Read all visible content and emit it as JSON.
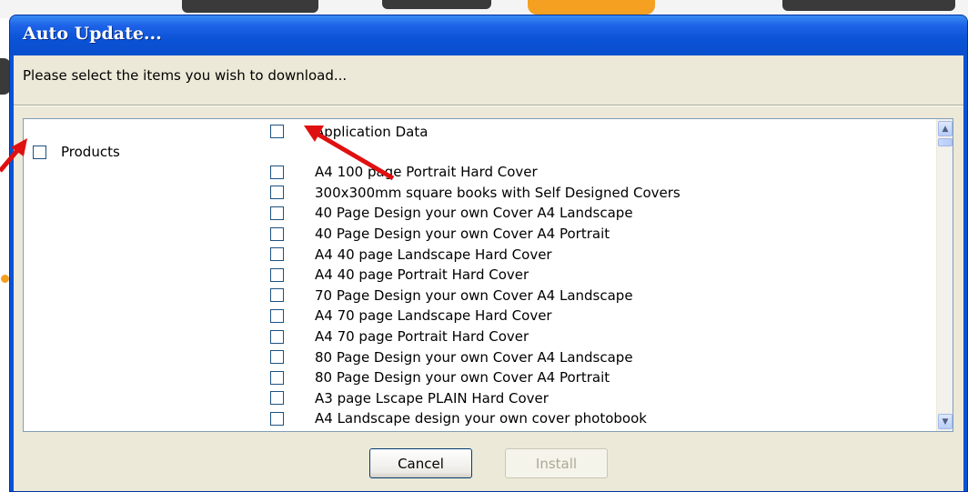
{
  "window": {
    "title": "Auto Update...",
    "prompt": "Please select the items you wish to download..."
  },
  "categories": [
    {
      "label": "Products",
      "checked": false
    }
  ],
  "items": [
    {
      "label": "Application Data",
      "checked": false
    },
    {
      "label": "A4 100 page Portrait Hard Cover",
      "checked": false
    },
    {
      "label": "300x300mm square books with Self Designed Covers",
      "checked": false
    },
    {
      "label": "40 Page Design your own Cover A4 Landscape",
      "checked": false
    },
    {
      "label": "40 Page Design your own Cover A4 Portrait",
      "checked": false
    },
    {
      "label": "A4 40 page Landscape Hard Cover",
      "checked": false
    },
    {
      "label": "A4 40 page Portrait Hard Cover",
      "checked": false
    },
    {
      "label": "70 Page Design your own Cover A4 Landscape",
      "checked": false
    },
    {
      "label": "A4 70 page Landscape Hard Cover",
      "checked": false
    },
    {
      "label": "A4 70 page Portrait Hard Cover",
      "checked": false
    },
    {
      "label": "80 Page Design your own Cover A4 Landscape",
      "checked": false
    },
    {
      "label": "80 Page Design your own Cover A4 Portrait",
      "checked": false
    },
    {
      "label": "A3 page Lscape PLAIN Hard Cover",
      "checked": false
    },
    {
      "label": "A4 Landscape design your own cover photobook",
      "checked": false
    }
  ],
  "buttons": {
    "cancel_label": "Cancel",
    "install_label": "Install",
    "install_enabled": false
  },
  "colors": {
    "titlebar": "#0a52d6",
    "dialog_body": "#ece9d8",
    "annotation_arrow": "#e01010"
  },
  "icons": {
    "scroll_up": "chevron-up-icon",
    "scroll_down": "chevron-down-icon"
  }
}
